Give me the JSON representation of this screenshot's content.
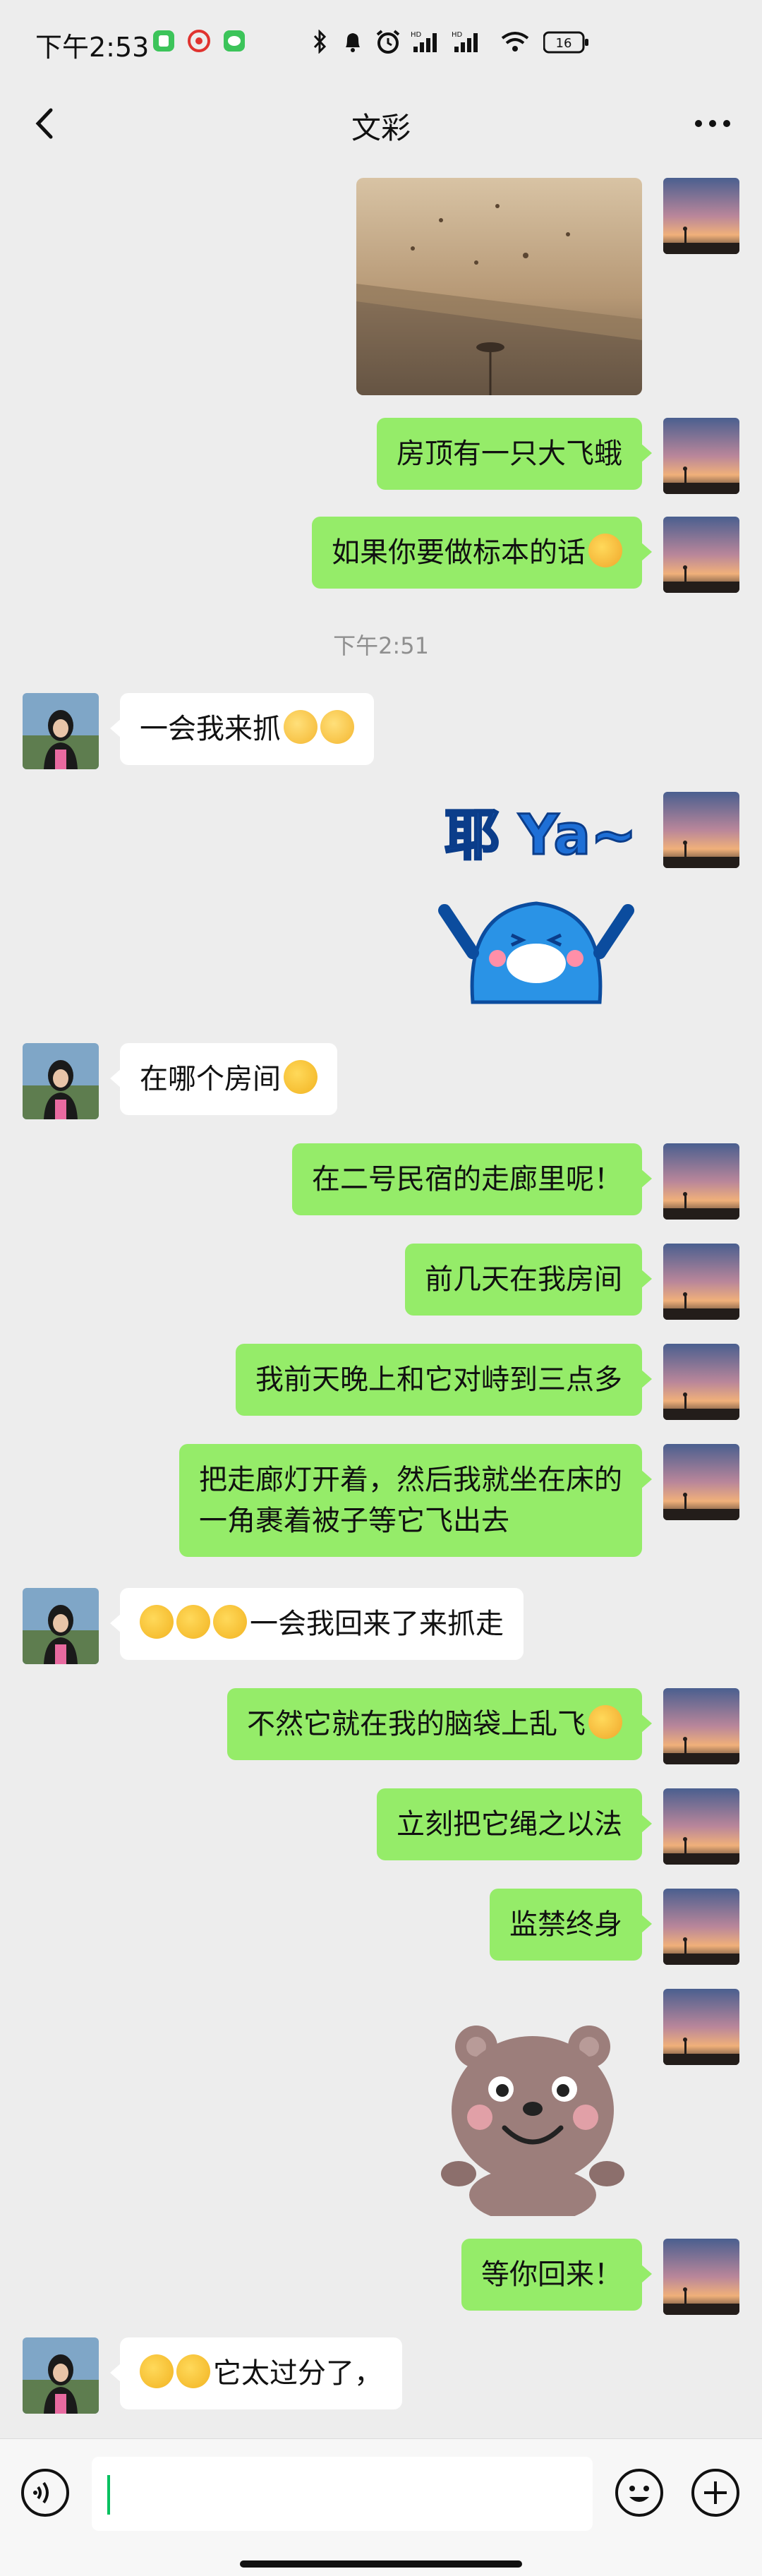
{
  "status_bar": {
    "time": "下午2:53",
    "battery": "16"
  },
  "nav": {
    "title": "文彩"
  },
  "messages": [
    {
      "kind": "photo",
      "side": "right"
    },
    {
      "kind": "text",
      "side": "right",
      "text": "房顶有一只大飞蛾"
    },
    {
      "kind": "text",
      "side": "right",
      "text": "如果你要做标本的话",
      "emoji": [
        "laugh"
      ]
    },
    {
      "kind": "time",
      "text": "下午2:51"
    },
    {
      "kind": "text",
      "side": "left",
      "text": "一会我来抓",
      "emoji": [
        "blush",
        "blush"
      ]
    },
    {
      "kind": "sticker",
      "side": "right",
      "sticker_text": "耶 Ya~"
    },
    {
      "kind": "text",
      "side": "left",
      "text": "在哪个房间",
      "emoji": [
        "think"
      ]
    },
    {
      "kind": "text",
      "side": "right",
      "text": "在二号民宿的走廊里呢！"
    },
    {
      "kind": "text",
      "side": "right",
      "text": "前几天在我房间"
    },
    {
      "kind": "text",
      "side": "right",
      "text": "我前天晚上和它对峙到三点多"
    },
    {
      "kind": "text",
      "side": "right",
      "lines": [
        "把走廊灯开着，然后我就坐在床的",
        "一角裹着被子等它飞出去"
      ]
    },
    {
      "kind": "text",
      "side": "left",
      "text": "一会我回来了来抓走",
      "emoji_prefix": [
        "think",
        "think",
        "think"
      ]
    },
    {
      "kind": "text",
      "side": "right",
      "text": "不然它就在我的脑袋上乱飞",
      "emoji": [
        "laugh"
      ]
    },
    {
      "kind": "text",
      "side": "right",
      "text": "立刻把它绳之以法"
    },
    {
      "kind": "text",
      "side": "right",
      "text": "监禁终身"
    },
    {
      "kind": "sticker",
      "side": "right",
      "sticker_text": ""
    },
    {
      "kind": "text",
      "side": "right",
      "text": "等你回来！"
    },
    {
      "kind": "text",
      "side": "left",
      "text": "它太过分了，",
      "emoji_prefix": [
        "think",
        "think"
      ]
    }
  ],
  "input": {
    "value": "",
    "voice_icon": "voice-icon",
    "emoji_icon": "emoji-icon",
    "add_icon": "plus-icon"
  }
}
